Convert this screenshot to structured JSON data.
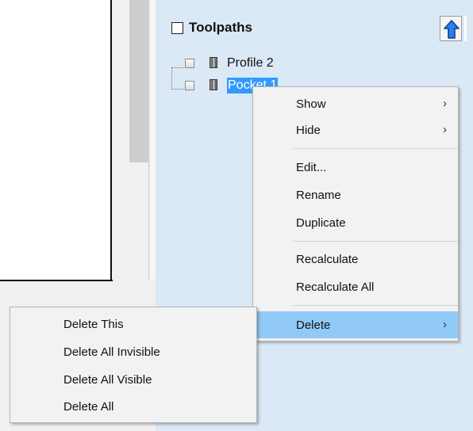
{
  "panel": {
    "title": "Toolpaths",
    "up_button_icon": "arrow-up-icon"
  },
  "tree": {
    "items": [
      {
        "label": "Profile 2",
        "selected": false
      },
      {
        "label": "Pocket 1",
        "selected": true
      }
    ]
  },
  "context_menu": {
    "items": [
      {
        "label": "Show",
        "has_submenu": true
      },
      {
        "label": "Hide",
        "has_submenu": true
      },
      {
        "label": "Edit..."
      },
      {
        "label": "Rename"
      },
      {
        "label": "Duplicate"
      },
      {
        "label": "Recalculate"
      },
      {
        "label": "Recalculate All"
      },
      {
        "label": "Delete",
        "has_submenu": true,
        "highlighted": true
      }
    ],
    "submenu_arrow": "›"
  },
  "delete_submenu": {
    "items": [
      {
        "label": "Delete This"
      },
      {
        "label": "Delete All Invisible"
      },
      {
        "label": "Delete All Visible"
      },
      {
        "label": "Delete All"
      }
    ]
  },
  "colors": {
    "panel_bg": "#dbe8f5",
    "selection": "#3399ff",
    "menu_hover": "#91c9f7",
    "menu_bg": "#f2f2f2"
  }
}
